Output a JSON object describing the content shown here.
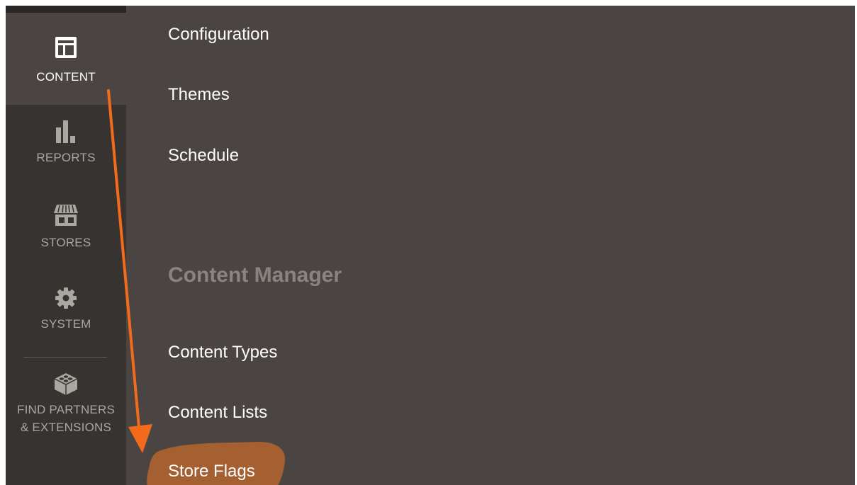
{
  "sidebar": {
    "items": [
      {
        "label": "CONTENT",
        "icon": "layout-icon",
        "active": true
      },
      {
        "label": "REPORTS",
        "icon": "bar-chart-icon"
      },
      {
        "label": "STORES",
        "icon": "storefront-icon"
      },
      {
        "label": "SYSTEM",
        "icon": "gear-icon"
      },
      {
        "label_line1": "FIND PARTNERS",
        "label_line2": "& EXTENSIONS",
        "icon": "lego-brick-icon"
      }
    ]
  },
  "submenu": {
    "links_top": [
      "Configuration",
      "Themes",
      "Schedule"
    ],
    "section_title": "Content Manager",
    "links_bottom": [
      "Content Types",
      "Content Lists",
      "Store Flags"
    ]
  },
  "annotations": {
    "highlight_color": "#b5652f",
    "arrow_color": "#f26b1d"
  },
  "colors": {
    "sidebar_bg": "#373330",
    "active_bg": "#4a4542",
    "submenu_bg": "#4a4542",
    "text_white": "#ffffff",
    "text_muted": "#aaa6a0",
    "section_title": "#8a8480"
  }
}
